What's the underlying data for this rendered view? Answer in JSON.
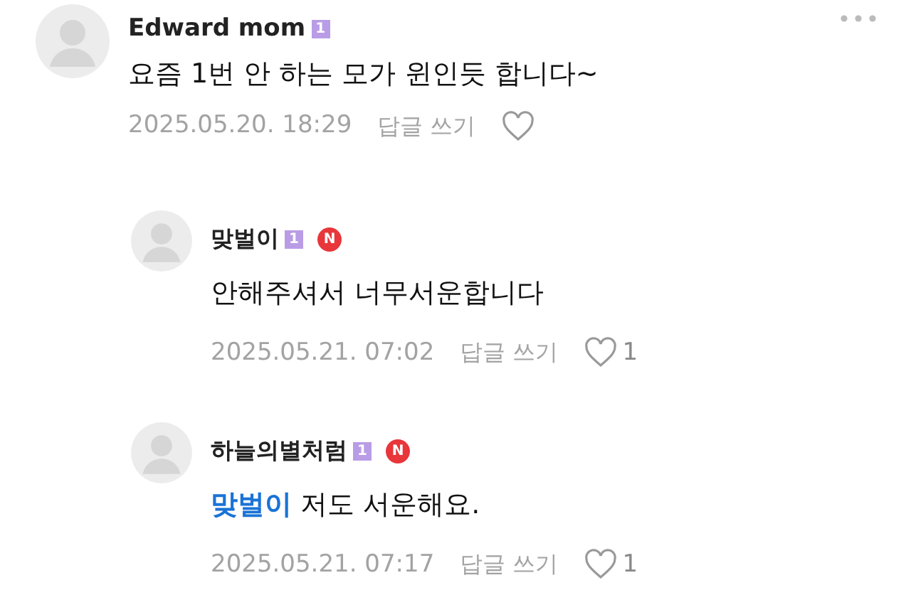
{
  "comments": [
    {
      "author": "Edward mom",
      "level_badge": "1",
      "text": "요즘 1번 안 하는 모가 윈인듯 합니다~",
      "time": "2025.05.20. 18:29",
      "reply_label": "답글 쓰기",
      "show_menu": true,
      "children": [
        {
          "author": "맞벌이",
          "level_badge": "1",
          "new_badge": "N",
          "text": "안해주셔서 너무서운합니다",
          "time": "2025.05.21. 07:02",
          "reply_label": "답글 쓰기",
          "likes": "1"
        },
        {
          "author": "하늘의별처럼",
          "level_badge": "1",
          "new_badge": "N",
          "mention": "맞벌이",
          "text": "저도 서운해요.",
          "time": "2025.05.21. 07:17",
          "reply_label": "답글 쓰기",
          "likes": "1"
        }
      ]
    }
  ]
}
